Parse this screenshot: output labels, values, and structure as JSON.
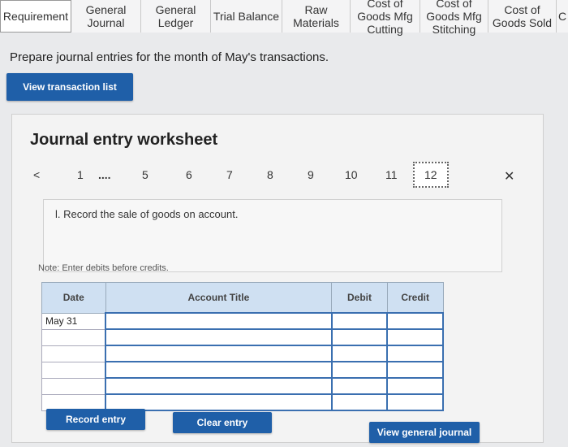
{
  "tabs": [
    {
      "label": "Requirement"
    },
    {
      "label": "General Journal"
    },
    {
      "label": "General Ledger"
    },
    {
      "label": "Trial Balance"
    },
    {
      "label": "Raw Materials"
    },
    {
      "label": "Cost of Goods Mfg Cutting"
    },
    {
      "label": "Cost of Goods Mfg Stitching"
    },
    {
      "label": "Cost of Goods Sold"
    },
    {
      "label": "C"
    }
  ],
  "instruction": "Prepare journal entries for the month of May's transactions.",
  "buttons": {
    "view_transaction_list": "View transaction list",
    "record_entry": "Record entry",
    "clear_entry": "Clear entry",
    "view_general_journal": "View general journal"
  },
  "worksheet": {
    "title": "Journal entry worksheet",
    "pager": {
      "prev": "<",
      "pages": [
        "1",
        "....",
        "5",
        "6",
        "7",
        "8",
        "9",
        "10",
        "11",
        "12"
      ],
      "active": "12",
      "next": "✕"
    },
    "description": "l. Record the sale of goods on account.",
    "note": "Note: Enter debits before credits.",
    "table": {
      "headers": [
        "Date",
        "Account Title",
        "Debit",
        "Credit"
      ],
      "rows": [
        {
          "date": "May 31",
          "account": "",
          "debit": "",
          "credit": ""
        },
        {
          "date": "",
          "account": "",
          "debit": "",
          "credit": ""
        },
        {
          "date": "",
          "account": "",
          "debit": "",
          "credit": ""
        },
        {
          "date": "",
          "account": "",
          "debit": "",
          "credit": ""
        },
        {
          "date": "",
          "account": "",
          "debit": "",
          "credit": ""
        },
        {
          "date": "",
          "account": "",
          "debit": "",
          "credit": ""
        }
      ]
    }
  }
}
